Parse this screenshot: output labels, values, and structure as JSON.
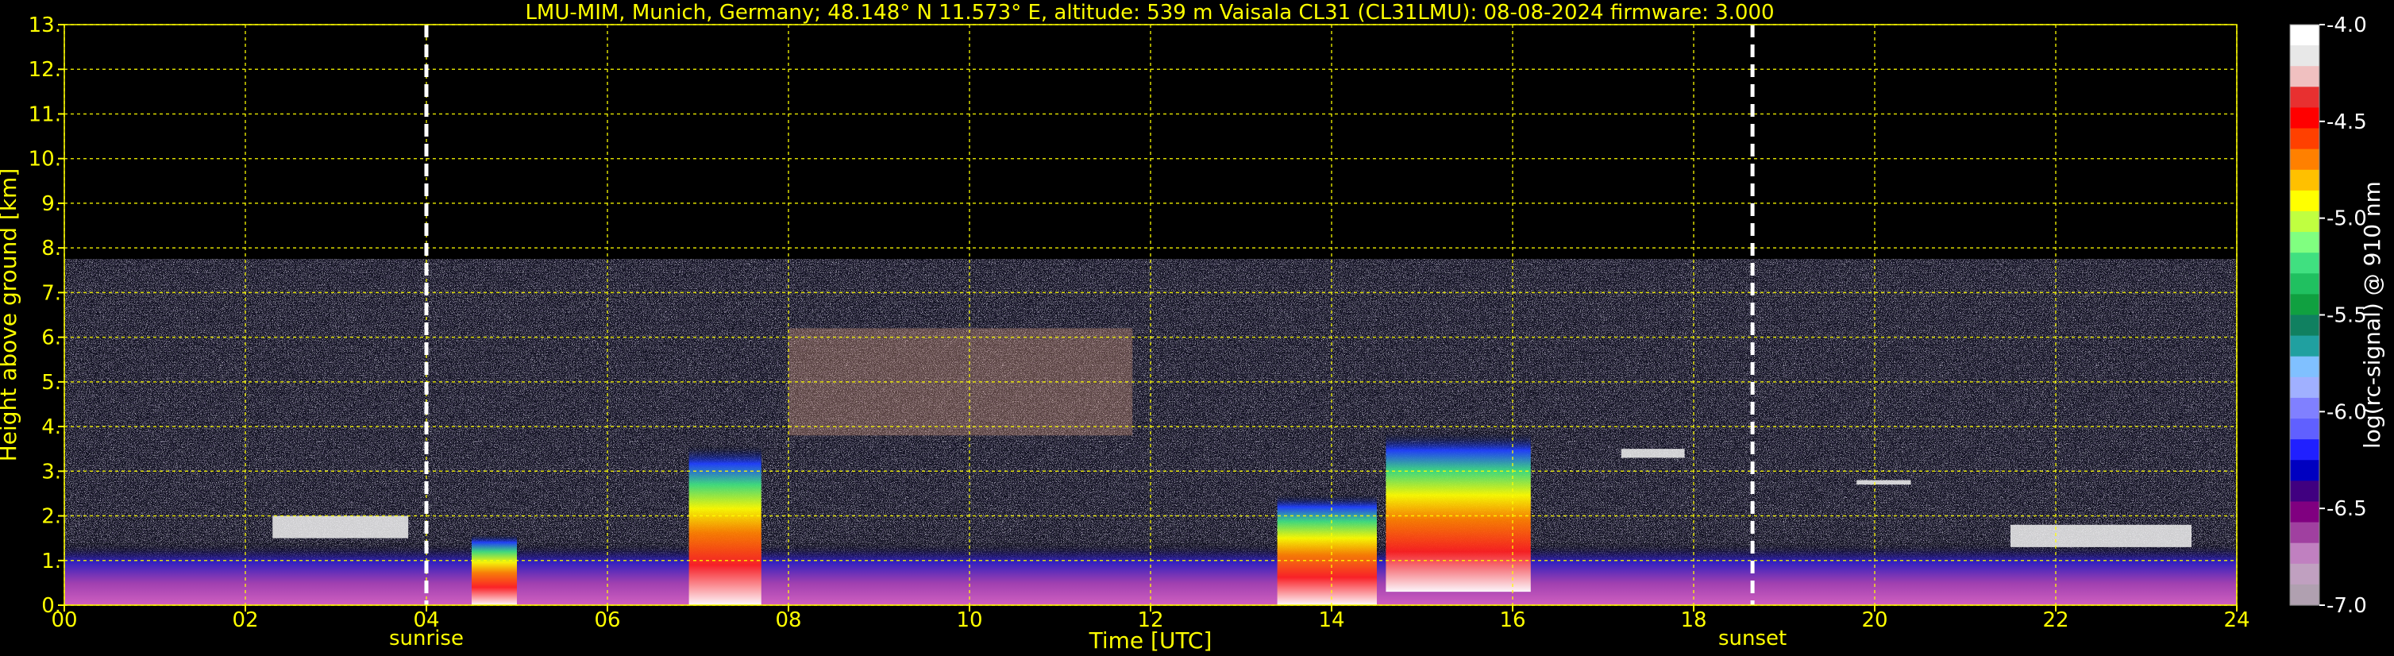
{
  "chart_data": {
    "type": "heatmap",
    "title": "LMU-MIM, Munich, Germany; 48.148° N 11.573° E, altitude: 539 m    Vaisala CL31 (CL31LMU): 08-08-2024    firmware: 3.000",
    "xlabel": "Time [UTC]",
    "ylabel": "Height above ground [km]",
    "xlim": [
      0,
      24
    ],
    "ylim": [
      0,
      13
    ],
    "xticks": [
      "00",
      "02",
      "04",
      "06",
      "08",
      "10",
      "12",
      "14",
      "16",
      "18",
      "20",
      "22",
      "24"
    ],
    "yticks": [
      "0.",
      "1.",
      "2.",
      "3.",
      "4.",
      "5.",
      "6.",
      "7.",
      "8.",
      "9.",
      "10.",
      "11.",
      "12.",
      "13."
    ],
    "grid": true,
    "grid_color": "#ffff00",
    "noise_top_km": 7.75,
    "events": [
      {
        "label": "sunrise",
        "x": 4.0
      },
      {
        "label": "sunset",
        "x": 18.65
      }
    ],
    "colorbar": {
      "label": "log(rc-signal) @ 910 nm",
      "ticks": [
        "-4.0",
        "-4.5",
        "-5.0",
        "-5.5",
        "-6.0",
        "-6.5",
        "-7.0"
      ],
      "range": [
        -7.0,
        -4.0
      ],
      "colors": [
        "#ffffff",
        "#e8e8e8",
        "#f0c0c0",
        "#e83030",
        "#ff0000",
        "#ff4000",
        "#ff8000",
        "#ffc000",
        "#ffff00",
        "#c0ff40",
        "#80ff80",
        "#40e080",
        "#20c060",
        "#10a040",
        "#108060",
        "#20a0a0",
        "#80c0ff",
        "#a0b0ff",
        "#8080ff",
        "#6060ff",
        "#2020ff",
        "#0000c0",
        "#400080",
        "#800080",
        "#a040a0",
        "#c080c0",
        "#c0a0c0",
        "#b0a0b0"
      ]
    },
    "cloud_features": [
      {
        "x0": 6.9,
        "x1": 7.7,
        "y0": 0.0,
        "y1": 3.6,
        "kind": "precip"
      },
      {
        "x0": 13.4,
        "x1": 14.5,
        "y0": 0.0,
        "y1": 2.5,
        "kind": "precip"
      },
      {
        "x0": 14.6,
        "x1": 16.2,
        "y0": 0.3,
        "y1": 3.9,
        "kind": "precip"
      },
      {
        "x0": 4.5,
        "x1": 5.0,
        "y0": 0.0,
        "y1": 1.6,
        "kind": "precip"
      },
      {
        "x0": 17.2,
        "x1": 17.9,
        "y0": 3.3,
        "y1": 3.5,
        "kind": "layer"
      },
      {
        "x0": 19.8,
        "x1": 20.4,
        "y0": 2.7,
        "y1": 2.8,
        "kind": "layer"
      },
      {
        "x0": 8.0,
        "x1": 11.8,
        "y0": 3.8,
        "y1": 6.2,
        "kind": "cirrus"
      },
      {
        "x0": 2.3,
        "x1": 3.8,
        "y0": 1.5,
        "y1": 2.0,
        "kind": "layer"
      },
      {
        "x0": 21.5,
        "x1": 23.5,
        "y0": 1.3,
        "y1": 1.8,
        "kind": "layer"
      }
    ]
  }
}
